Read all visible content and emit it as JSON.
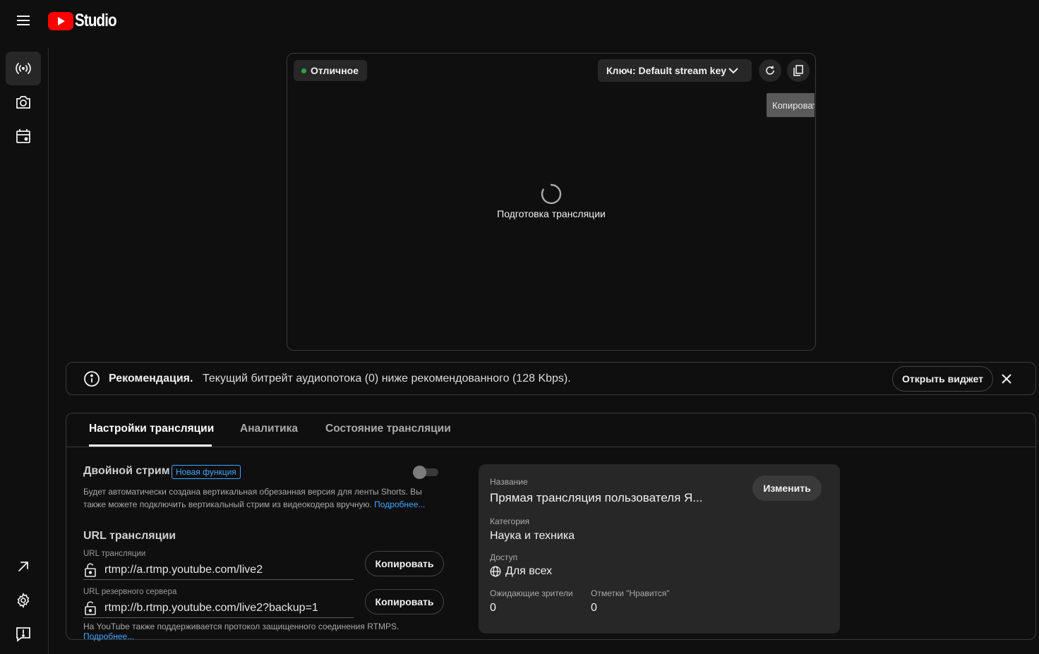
{
  "header": {
    "logo_text": "Studio"
  },
  "preview": {
    "status_label": "Отличное",
    "stream_key_label": "Ключ: Default stream key (I",
    "tooltip": "Копировать",
    "preparing_text": "Подготовка трансляции"
  },
  "recommendation": {
    "title": "Рекомендация.",
    "text": "Текущий битрейт аудиопотока (0) ниже рекомендованного (128 Kbps).",
    "open_widget_label": "Открыть виджет"
  },
  "tabs": [
    {
      "label": "Настройки трансляции"
    },
    {
      "label": "Аналитика"
    },
    {
      "label": "Состояние трансляции"
    }
  ],
  "dual_stream": {
    "title": "Двойной стрим",
    "badge": "Новая функция",
    "enabled": false,
    "description": "Будет автоматически создана вертикальная обрезанная версия для ленты Shorts. Вы также можете подключить вертикальный стрим из видеокодера вручную.",
    "more_link": "Подробнее..."
  },
  "stream_url": {
    "heading": "URL трансляции",
    "primary_label": "URL трансляции",
    "primary_value": "rtmp://a.rtmp.youtube.com/live2",
    "backup_label": "URL резервного сервера",
    "backup_value": "rtmp://b.rtmp.youtube.com/live2?backup=1",
    "copy_label": "Копировать",
    "rtmps_note": "На YouTube также поддерживается протокол защищенного соединения RTMPS.",
    "rtmps_link": "Подробнее..."
  },
  "info_card": {
    "title_label": "Название",
    "title_value": "Прямая трансляция пользователя Я...",
    "edit_label": "Изменить",
    "category_label": "Категория",
    "category_value": "Наука и техника",
    "access_label": "Доступ",
    "access_value": "Для всех",
    "waiting_label": "Ожидающие зрители",
    "waiting_value": "0",
    "likes_label": "Отметки \"Нравится\"",
    "likes_value": "0"
  },
  "colors": {
    "background": "#0f0f0f",
    "surface": "#272727",
    "accent_red": "#ff0000",
    "link_blue": "#3ea6ff",
    "status_green": "#2ba640"
  },
  "icons": [
    "menu-icon",
    "youtube-logo-icon",
    "live-broadcast-icon",
    "camera-icon",
    "calendar-icon",
    "external-link-icon",
    "settings-icon",
    "feedback-icon",
    "refresh-icon",
    "copy-icon",
    "chevron-down-icon",
    "info-icon",
    "close-icon",
    "lock-icon",
    "globe-icon",
    "loading-spinner-icon"
  ]
}
